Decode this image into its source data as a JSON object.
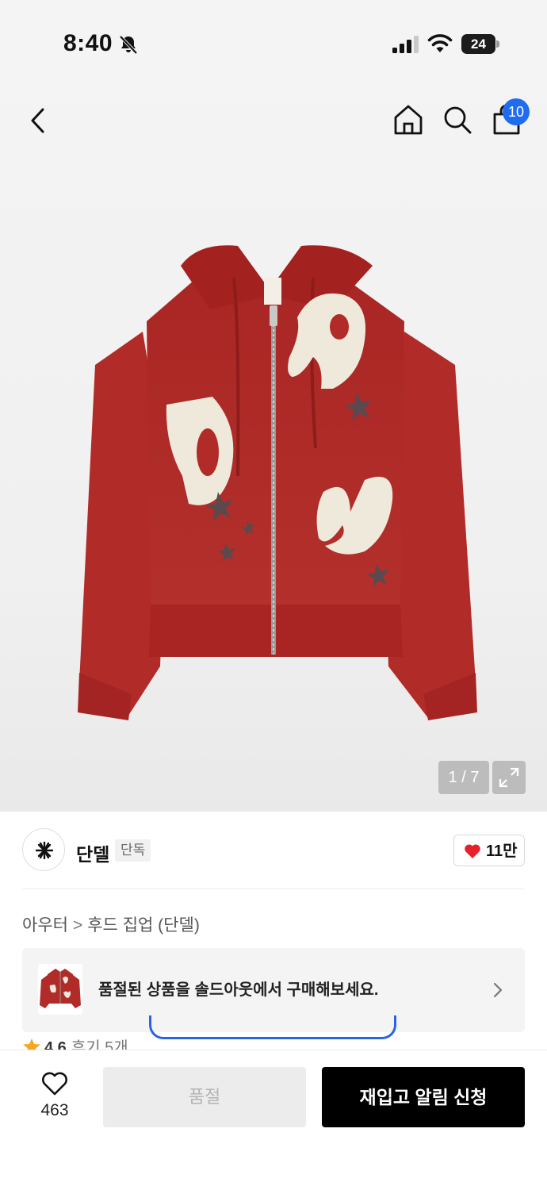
{
  "status_bar": {
    "time": "8:40",
    "battery": "24"
  },
  "header": {
    "cart_count": "10"
  },
  "gallery": {
    "counter": "1 / 7"
  },
  "brand": {
    "name": "단델",
    "badge": "단독",
    "likes": "11만"
  },
  "breadcrumb": {
    "category": "아우터",
    "separator": ">",
    "subcategory": "후드 집업 (단델)"
  },
  "soldout_banner": {
    "text": "품절된 상품을 솔드아웃에서 구매해보세요."
  },
  "rating": {
    "score": "4.6",
    "reviews": "후기 5개"
  },
  "bottom_bar": {
    "wish_count": "463",
    "soldout_label": "품절",
    "restock_label": "재입고 알림 신청"
  },
  "colors": {
    "accent_blue": "#1f6cf0",
    "heart_red": "#e8202a",
    "star_orange": "#f5a623",
    "hoodie_red": "#b02a27",
    "patch_cream": "#efe9dc"
  }
}
